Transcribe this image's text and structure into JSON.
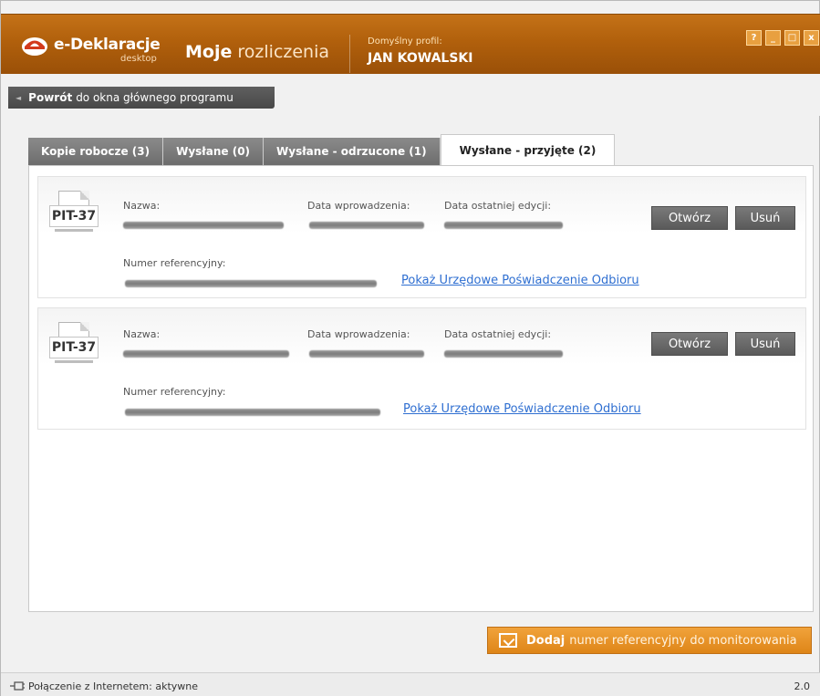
{
  "header": {
    "logo_title": "e-Deklaracje",
    "logo_subtitle": "desktop",
    "app_title_bold": "Moje",
    "app_title_rest": " rozliczenia",
    "profile_label": "Domyślny profil:",
    "profile_name": "JAN KOWALSKI",
    "window_buttons": [
      "?",
      "_",
      "□",
      "x"
    ]
  },
  "back": {
    "bold": "Powrót",
    "rest": "do okna głównego programu"
  },
  "tabs": [
    {
      "label": "Kopie robocze (3)",
      "active": false
    },
    {
      "label": "Wysłane (0)",
      "active": false
    },
    {
      "label": "Wysłane - odrzucone (1)",
      "active": false
    },
    {
      "label": "Wysłane - przyjęte (2)",
      "active": true
    }
  ],
  "items": [
    {
      "form": "PIT-37",
      "name_label": "Nazwa:",
      "entry_date_label": "Data wprowadzenia:",
      "last_edit_label": "Data ostatniej edycji:",
      "reference_label": "Numer referencyjny:",
      "open_label": "Otwórz",
      "delete_label": "Usuń",
      "upo_link": "Pokaż Urzędowe Poświadczenie Odbioru"
    },
    {
      "form": "PIT-37",
      "name_label": "Nazwa:",
      "entry_date_label": "Data wprowadzenia:",
      "last_edit_label": "Data ostatniej edycji:",
      "reference_label": "Numer referencyjny:",
      "open_label": "Otwórz",
      "delete_label": "Usuń",
      "upo_link": "Pokaż Urzędowe Poświadczenie Odbioru"
    }
  ],
  "add_button": {
    "bold": "Dodaj",
    "rest": "numer referencyjny do monitorowania"
  },
  "status": {
    "connection": "Połączenie z Internetem: aktywne",
    "version": "2.0"
  },
  "colors": {
    "header_orange": "#b1600c",
    "accent_orange": "#e8901f",
    "button_gray": "#666666",
    "link_blue": "#2f6fd1"
  }
}
